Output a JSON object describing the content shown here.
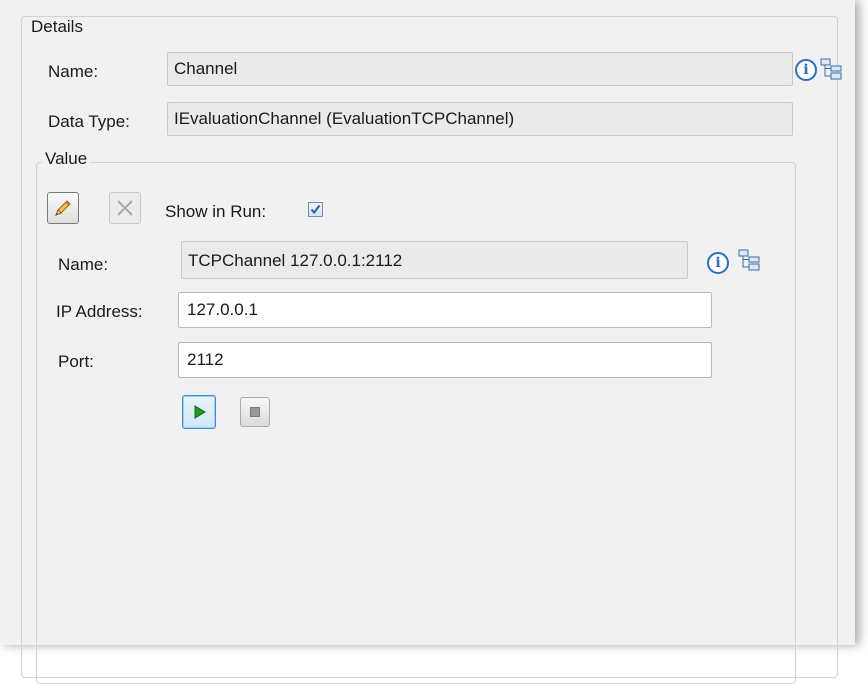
{
  "details": {
    "legend": "Details",
    "name_label": "Name:",
    "name_value": "Channel",
    "datatype_label": "Data Type:",
    "datatype_value": "IEvaluationChannel (EvaluationTCPChannel)"
  },
  "value": {
    "legend": "Value",
    "show_in_run_label": "Show in Run:",
    "show_in_run_checked": true,
    "name_label": "Name:",
    "name_value": "TCPChannel 127.0.0.1:2112",
    "ip_label": "IP Address:",
    "ip_value": "127.0.0.1",
    "port_label": "Port:",
    "port_value": "2112"
  },
  "icons": {
    "info": "info-icon",
    "tree": "hierarchy-icon",
    "edit": "pencil-icon",
    "delete": "close-icon",
    "start": "play-icon",
    "stop": "stop-icon"
  },
  "colors": {
    "panel_bg": "#f1f1f1",
    "info_blue": "#2b6fc5",
    "play_green": "#1f9a1f",
    "checkbox_blue": "#2d5f9a"
  }
}
